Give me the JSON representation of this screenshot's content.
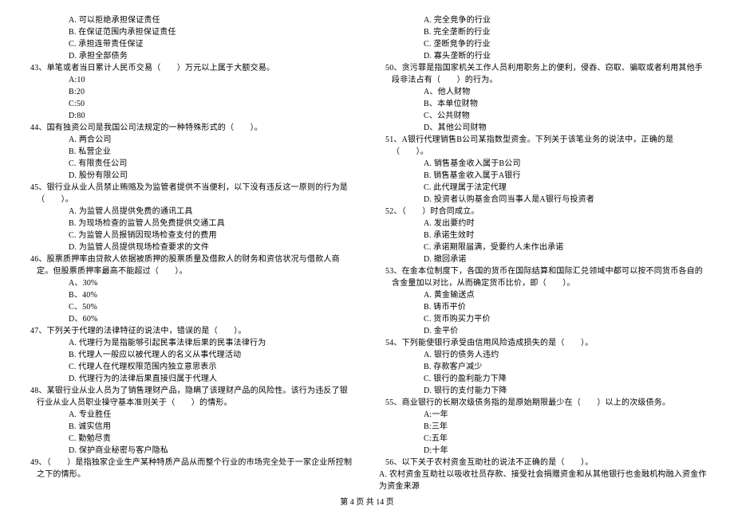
{
  "left": {
    "pre_opts": [
      "A. 可以拒绝承担保证责任",
      "B. 在保证范围内承担保证责任",
      "C. 承担连带责任保证",
      "D. 承担全部债务"
    ],
    "q43": "43、单笔或者当日累计人民币交易（　　）万元以上属于大额交易。",
    "q43_opts": [
      "A:10",
      "B:20",
      "C:50",
      "D:80"
    ],
    "q44": "44、国有独资公司是我国公司法规定的一种特殊形式的（　　）。",
    "q44_opts": [
      "A. 两合公司",
      "B. 私营企业",
      "C. 有限责任公司",
      "D. 股份有限公司"
    ],
    "q45": "45、银行业从业人员禁止贿赂及为监管者提供不当便利，以下没有违反这一原则的行为是（　　）。",
    "q45_opts": [
      "A. 为监管人员提供免费的通讯工具",
      "B. 为现场检查的监管人员免费提供交通工具",
      "C. 为监管人员报销因现场检查支付的费用",
      "D. 为监管人员提供现场检查要求的文件"
    ],
    "q46": "46、股票质押率由贷款人依据被质押的股票质量及借款人的财务和资信状况与借款人商定。但股票质押率最高不能超过（　　）。",
    "q46_opts": [
      "A、30%",
      "B、40%",
      "C、50%",
      "D、60%"
    ],
    "q47": "47、下列关于代理的法律特征的说法中，错误的是（　　）。",
    "q47_opts": [
      "A. 代理行为是指能够引起民事法律后果的民事法律行为",
      "B. 代理人一般应以被代理人的名义从事代理活动",
      "C. 代理人在代理权限范围内独立意思表示",
      "D. 代理行为的法律后果直接归属于代理人"
    ],
    "q48": "48、某银行业从业人员为了销售理财产品，隐瞒了该理财产品的风险性。该行为违反了银行业从业人员职业操守基本准则关于（　　）的情形。",
    "q48_opts": [
      "A. 专业胜任",
      "B. 诚实信用",
      "C. 勤勉尽责",
      "D. 保护商业秘密与客户隐私"
    ],
    "q49": "49、（　　）是指独家企业生产某种特质产品从而整个行业的市场完全处于一家企业所控制之下的情形。"
  },
  "right": {
    "pre_opts": [
      "A. 完全竞争的行业",
      "B. 完全垄断的行业",
      "C. 垄断竞争的行业",
      "D. 寡头垄断的行业"
    ],
    "q50": "50、贪污罪是指国家机关工作人员利用职务上的便利，侵吞、窃取、骗取或者利用其他手段非法占有（　　）的行为。",
    "q50_opts": [
      "A、他人财物",
      "B、本单位财物",
      "C、公共财物",
      "D、其他公司财物"
    ],
    "q51": "51、A银行代理销售B公司某指数型资金。下列关于该笔业务的说法中，正确的是（　　）。",
    "q51_opts": [
      "A. 销售基金收入属于B公司",
      "B. 销售基金收入属于A银行",
      "C. 此代理属于法定代理",
      "D. 投资者认购基金合同当事人是A银行与投资者"
    ],
    "q52": "52、（　　）时合同成立。",
    "q52_opts": [
      "A. 发出要约时",
      "B. 承诺生效时",
      "C. 承诺期限届满，受要约人未作出承诺",
      "D. 撤回承诺"
    ],
    "q53": "53、在金本位制度下，各国的货币在国际结算和国际汇兑领域中都可以按不同货币各自的含金量加以对比，从而确定货币比价，即（　　）。",
    "q53_opts": [
      "A. 黄金输送点",
      "B. 铸币平价",
      "C. 货币购买力平价",
      "D. 金平价"
    ],
    "q54": "54、下列能使银行承受由信用风险造成损失的是（　　）。",
    "q54_opts": [
      "A. 银行的债务人违约",
      "B. 存款客户减少",
      "C. 银行的盈利能力下降",
      "D. 银行的支付能力下降"
    ],
    "q55": "55、商业银行的长期次级债务指的是原始期限最少在（　　）以上的次级债务。",
    "q55_opts": [
      "A:一年",
      "B:三年",
      "C:五年",
      "D:十年"
    ],
    "q56": "56、以下关于农村资金互助社的说法不正确的是（　　）。",
    "q56_cont": "A. 农村资金互助社以吸收社员存款、接受社会捐赠资金和从其他银行也金融机构融入资金作为资金来源"
  },
  "footer": "第 4 页 共 14 页"
}
